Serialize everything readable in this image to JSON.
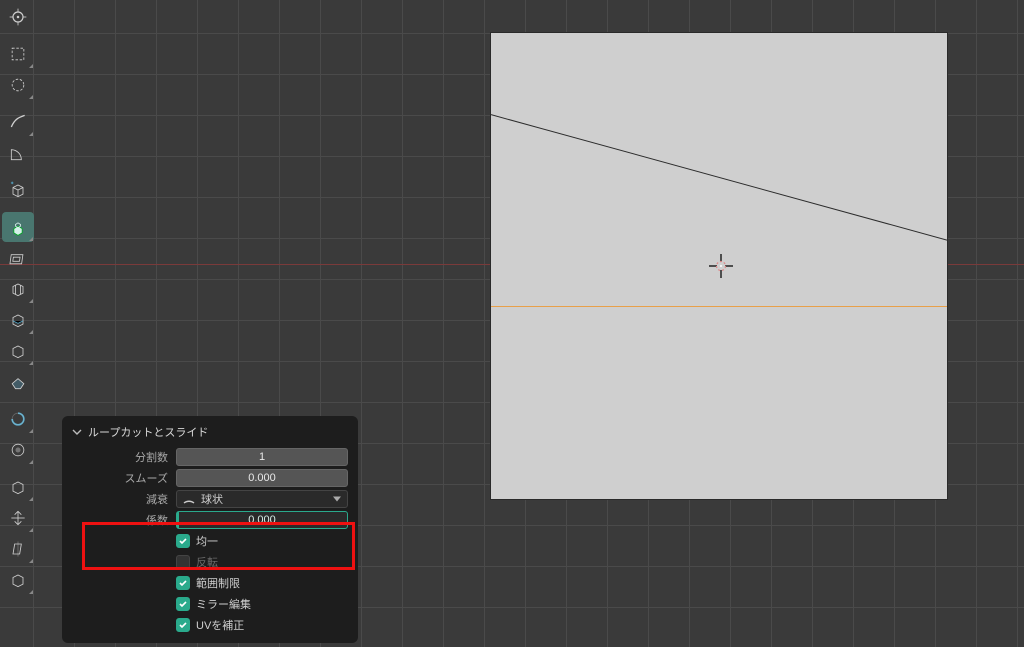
{
  "operator": {
    "title": "ループカットとスライド",
    "rows": {
      "cuts_label": "分割数",
      "cuts_value": "1",
      "smooth_label": "スムーズ",
      "smooth_value": "0.000",
      "falloff_label": "減衰",
      "falloff_value": "球状",
      "factor_label": "係数",
      "factor_value": "0.000"
    },
    "checks": {
      "even": "均一",
      "flipped": "反転",
      "clamp": "範囲制限",
      "mirror": "ミラー編集",
      "uv": "UVを補正"
    }
  },
  "tools": [
    "cursor",
    "select",
    "circle-select",
    "annotate",
    "measure",
    "add-cube",
    "extrude",
    "inset",
    "bevel",
    "loop-cut",
    "knife",
    "poly-build",
    "spin",
    "smooth",
    "edge-slide",
    "shrink-fatten",
    "shear",
    "rip"
  ]
}
